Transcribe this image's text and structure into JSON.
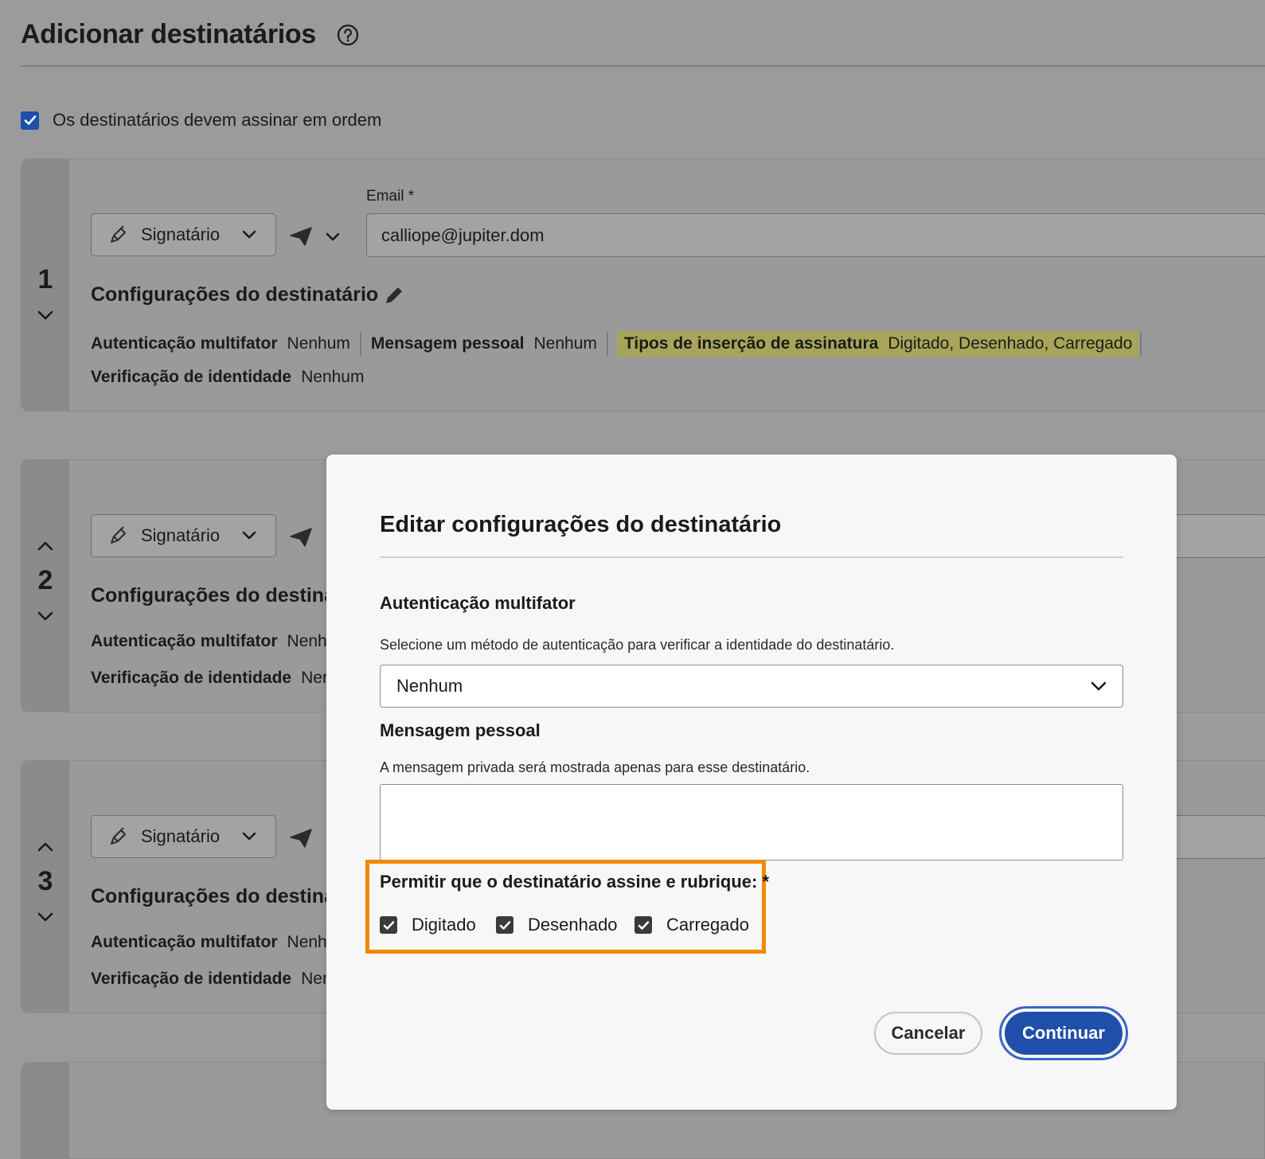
{
  "page": {
    "title": "Adicionar destinatários",
    "help_icon": "question-circle-icon",
    "order_checkbox": {
      "label": "Os destinatários devem assinar em ordem",
      "checked": true
    }
  },
  "recipients": [
    {
      "number": "1",
      "role": "Signatário",
      "email_label": "Email",
      "email_required_mark": "*",
      "email": "calliope@jupiter.dom",
      "settings_title": "Configurações do destinatário",
      "mfa_label": "Autenticação multifator",
      "mfa_value": "Nenhum",
      "personal_msg_label": "Mensagem pessoal",
      "personal_msg_value": "Nenhum",
      "sig_types_label": "Tipos de inserção de assinatura",
      "sig_types_value": "Digitado, Desenhado, Carregado",
      "id_check_label": "Verificação de identidade",
      "id_check_value": "Nenhum"
    },
    {
      "number": "2",
      "role": "Signatário",
      "settings_title": "Configurações do destinat",
      "mfa_label": "Autenticação multifator",
      "mfa_value": "Nenh",
      "id_check_label": "Verificação de identidade",
      "id_check_value": "Ner"
    },
    {
      "number": "3",
      "role": "Signatário",
      "settings_title": "Configurações do destinat",
      "mfa_label": "Autenticação multifator",
      "mfa_value": "Nenh",
      "id_check_label": "Verificação de identidade",
      "id_check_value": "Ner"
    }
  ],
  "modal": {
    "title": "Editar configurações do destinatário",
    "mfa_heading": "Autenticação multifator",
    "mfa_desc": "Selecione um método de autenticação para verificar a identidade do destinatário.",
    "mfa_selected": "Nenhum",
    "msg_heading": "Mensagem pessoal",
    "msg_desc": "A mensagem privada será mostrada apenas para esse destinatário.",
    "msg_value": "",
    "allow_label": "Permitir que o destinatário assine e rubrique: *",
    "options": [
      {
        "label": "Digitado",
        "checked": true
      },
      {
        "label": "Desenhado",
        "checked": true
      },
      {
        "label": "Carregado",
        "checked": true
      }
    ],
    "cancel_label": "Cancelar",
    "continue_label": "Continuar"
  },
  "colors": {
    "accent": "#1f4fa8",
    "highlight_outline": "#f08a00",
    "sig_types_highlight": "#a8a55a"
  }
}
